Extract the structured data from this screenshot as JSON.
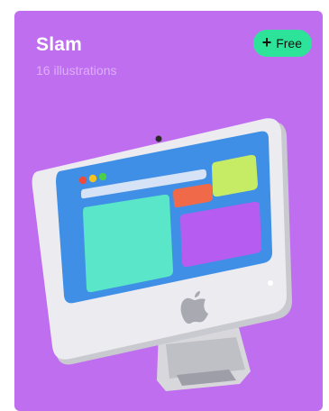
{
  "card": {
    "title": "Slam",
    "subtitle": "16 illustrations",
    "badge": {
      "icon": "plus-icon",
      "label": "Free"
    }
  },
  "colors": {
    "card_background": "#c06ef0",
    "badge_background": "#2de39a",
    "screen_blue": "#3f8fe6",
    "panel_teal": "#5ae6c8",
    "panel_purple": "#b75cf0",
    "panel_red": "#f06a4a",
    "panel_lime": "#c6ec66"
  }
}
